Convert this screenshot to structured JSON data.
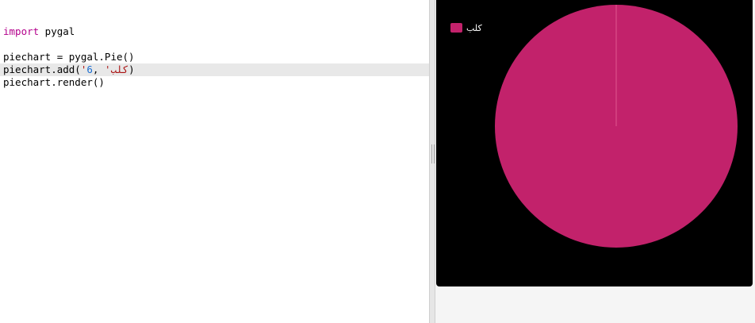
{
  "editor": {
    "lines": {
      "line1": {
        "kw": "import",
        "rest": " pygal"
      },
      "line2": {
        "text": "piechart = pygal.Pie()"
      },
      "line3": {
        "prefix": "piechart.add(",
        "quote1": "'",
        "arabic": "كلب",
        "quote2": "'",
        "comma": ", ",
        "num": "6",
        "suffix": ")"
      },
      "line4": {
        "text": "piechart.render()"
      }
    }
  },
  "chart_data": {
    "type": "pie",
    "categories": [
      "كلب"
    ],
    "values": [
      6
    ],
    "series": [
      {
        "name": "كلب",
        "values": [
          6
        ],
        "color": "#c2226b"
      }
    ],
    "legend_position": "top-left",
    "background": "#000000"
  },
  "colors": {
    "keyword": "#b4008c",
    "string": "#aa1111",
    "number": "#1a6dd1",
    "slice": "#c2226b",
    "active_line": "#e8e8e8"
  }
}
